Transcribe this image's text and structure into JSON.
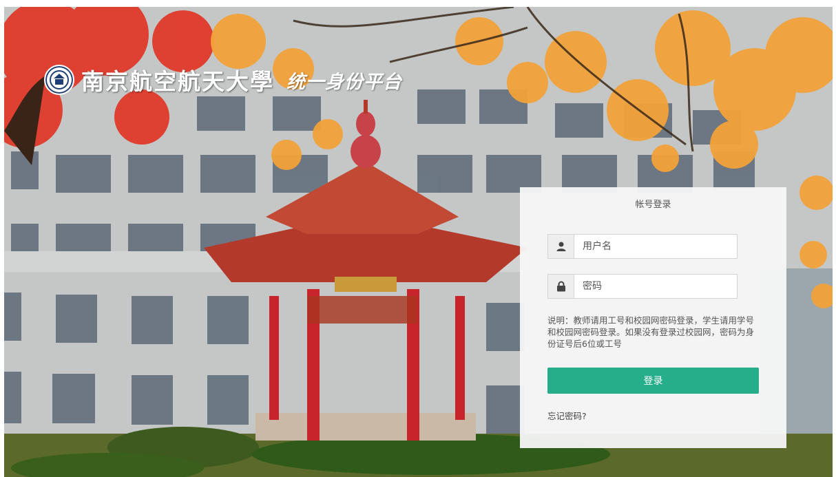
{
  "header": {
    "university_name": "南京航空航天大學",
    "platform_name": "统一身份平台",
    "logo": "university-seal-icon"
  },
  "login": {
    "title": "帐号登录",
    "username_placeholder": "用户名",
    "password_placeholder": "密码",
    "user_icon": "user-icon",
    "lock_icon": "lock-icon",
    "note": "说明：教师请用工号和校园网密码登录，学生请用学号和校园网密码登录。如果没有登录过校园网，密码为身份证号后6位或工号",
    "login_button": "登录",
    "forgot_password": "忘记密码?"
  },
  "colors": {
    "accent": "#26ae8a",
    "panel_background": "#f7f7f7"
  }
}
